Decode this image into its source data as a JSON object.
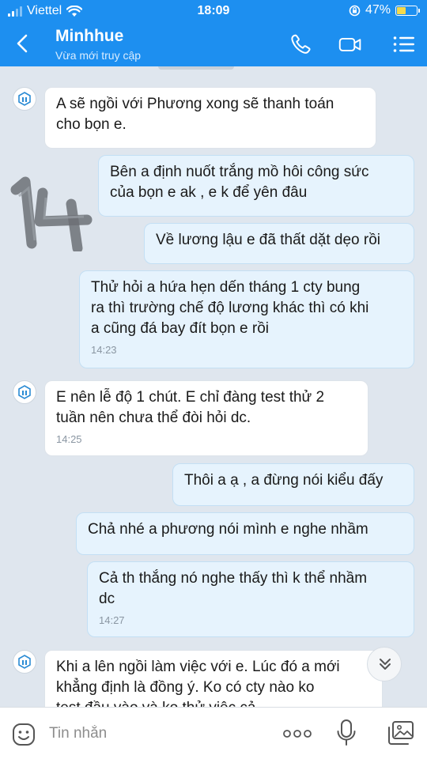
{
  "status_bar": {
    "carrier": "Viettel",
    "time": "18:09",
    "battery": "47%",
    "battery_level": 0.47
  },
  "header": {
    "name": "Minhhue",
    "status": "Vừa mới truy cập",
    "icons": [
      "back-arrow-icon",
      "phone-icon",
      "video-camera-icon",
      "menu-list-icon"
    ]
  },
  "messages": [
    {
      "side": "in",
      "text": "A sẽ ngồi với Phương xong sẽ thanh toán\ncho bọn e.",
      "time": ""
    },
    {
      "side": "out",
      "text": "Bên a định nuốt trắng mồ hôi công sức\ncủa bọn e ak , e k để yên đâu",
      "time": ""
    },
    {
      "side": "out",
      "text": "Về lương lậu e đã thất dặt dẹo rồi",
      "time": ""
    },
    {
      "side": "out",
      "text": " Thử hỏi a hứa hẹn dến tháng 1 cty bung\nra thì trường chế độ lương khác thì có khi\na cũng đá bay đít bọn e rồi",
      "time": "14:23"
    },
    {
      "side": "in",
      "text": "E nên lễ độ 1 chút. E chỉ đàng test thử 2\ntuần nên chưa thể đòi hỏi dc.",
      "time": "14:25"
    },
    {
      "side": "out",
      "text": "Thôi a ạ , a đừng nói kiểu đấy",
      "time": ""
    },
    {
      "side": "out",
      "text": "Chả nhé a phương nói mình e nghe nhầm",
      "time": ""
    },
    {
      "side": "out",
      "text": "Cả th thắng nó nghe thấy thì k thể nhầm\ndc",
      "time": "14:27"
    },
    {
      "side": "in",
      "text": "Khi a lên ngồi làm việc với e. Lúc đó a mới\nkhẳng định là đồng ý. Ko có cty nào ko\ntest đầu vào và ko thử việc cả",
      "time": ""
    }
  ],
  "input": {
    "placeholder": "Tin nhắn"
  },
  "colors": {
    "header": "#1d8ff0",
    "chat_background": "#dfe6ee",
    "incoming_bubble": "#ffffff",
    "outgoing_bubble": "#e6f3fd"
  }
}
